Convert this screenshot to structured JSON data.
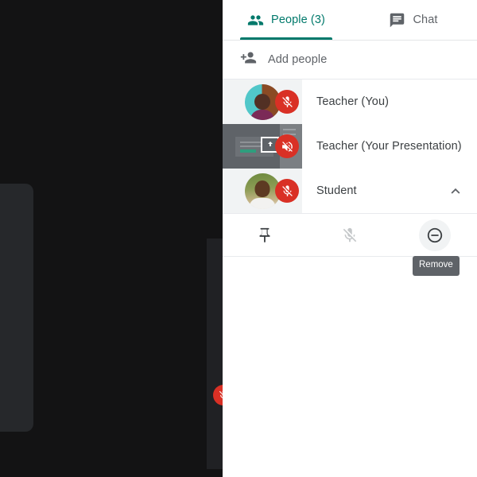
{
  "tabs": [
    {
      "label": "People (3)",
      "icon": "people-icon",
      "active": true
    },
    {
      "label": "Chat",
      "icon": "chat-icon",
      "active": false
    }
  ],
  "add_people": {
    "label": "Add people",
    "icon": "person-add-icon"
  },
  "participants": [
    {
      "name": "Teacher (You)",
      "avatar_kind": "photo",
      "badge": "mic-off-icon",
      "expanded": false,
      "presenting": false
    },
    {
      "name": "Teacher (Your Presentation)",
      "avatar_kind": "presentation-thumbnail",
      "badge": "volume-off-icon",
      "expanded": false,
      "presenting": true
    },
    {
      "name": "Student",
      "avatar_kind": "photo",
      "badge": "mic-off-icon",
      "expanded": true,
      "presenting": false,
      "chevron": "chevron-up-icon"
    }
  ],
  "actions": [
    {
      "name": "pin",
      "icon": "pin-icon",
      "state": "enabled"
    },
    {
      "name": "mute",
      "icon": "mic-off-icon",
      "state": "disabled"
    },
    {
      "name": "remove",
      "icon": "remove-circle-icon",
      "state": "hovered"
    }
  ],
  "tooltip": {
    "text": "Remove"
  },
  "stage": {
    "self_view_label": "",
    "main_tile_badge": "mic-off-icon"
  },
  "colors": {
    "accent": "#00796b",
    "muted_red": "#d93025",
    "panel_bg": "#ffffff",
    "avatar_cell_bg": "#f1f3f4",
    "presenting_cell_bg": "#5f6368",
    "text_primary": "#3c4043",
    "text_secondary": "#5f6368",
    "stage_bg": "#131314",
    "tooltip_bg": "#5f6368"
  }
}
